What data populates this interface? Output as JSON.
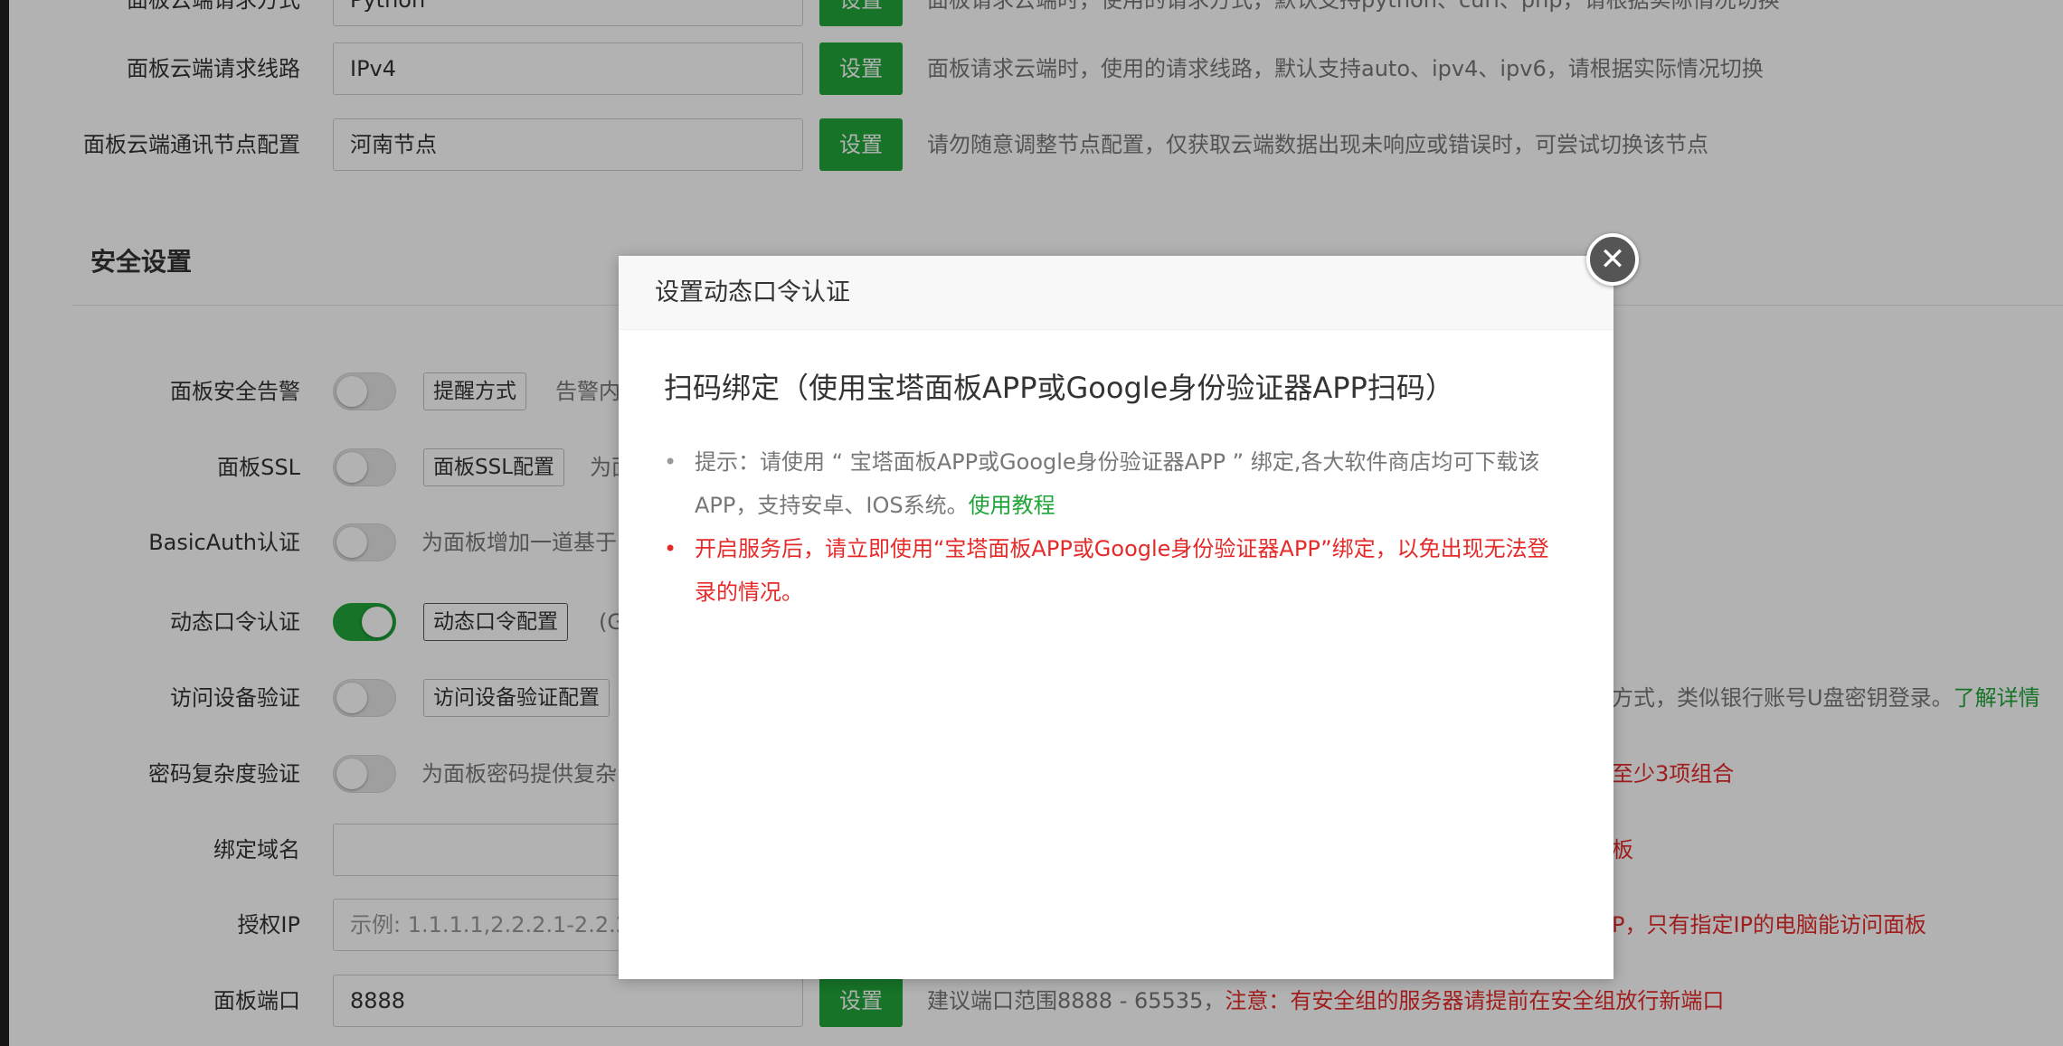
{
  "rows_top": [
    {
      "label": "面板云端请求方式",
      "value": "Python",
      "button": "设置",
      "hint": "面板请求云端时，使用的请求方式，默认支持python、curl、php，请根据实际情况切换"
    },
    {
      "label": "面板云端请求线路",
      "value": "IPv4",
      "button": "设置",
      "hint": "面板请求云端时，使用的请求线路，默认支持auto、ipv4、ipv6，请根据实际情况切换"
    },
    {
      "label": "面板云端通讯节点配置",
      "value": "河南节点",
      "button": "设置",
      "hint": "请勿随意调整节点配置，仅获取云端数据出现未响应或错误时，可尝试切换该节点"
    }
  ],
  "section": {
    "title": "安全设置"
  },
  "security_rows": [
    {
      "label": "面板安全告警",
      "enabled": false,
      "button": "提醒方式",
      "hint": "告警内"
    },
    {
      "label": "面板SSL",
      "enabled": false,
      "button": "面板SSL配置",
      "hint": "为面"
    },
    {
      "label": "BasicAuth认证",
      "enabled": false,
      "hint": "为面板增加一道基于"
    },
    {
      "label": "动态口令认证",
      "enabled": true,
      "button": "动态口令配置",
      "hint": "(G"
    },
    {
      "label": "访问设备验证",
      "enabled": false,
      "button": "访问设备验证配置",
      "hint_right": "方式，类似银行账号U盘密钥登录。",
      "hint_right_link": "了解详情"
    },
    {
      "label": "密码复杂度验证",
      "enabled": false,
      "hint": "为面板密码提供复杂",
      "hint_right": "至少3项组合"
    }
  ],
  "domain_row": {
    "label": "绑定域名",
    "value": "",
    "hint_right": "板"
  },
  "ip_row": {
    "label": "授权IP",
    "placeholder": "示例: 1.1.1.1,2.2.2.1-2.2.2.2",
    "hint_right": "P，只有指定IP的电脑能访问面板"
  },
  "port_row": {
    "label": "面板端口",
    "value": "8888",
    "button": "设置",
    "hint": "建议端口范围8888 - 65535，",
    "hint_red": "注意：有安全组的服务器请提前在安全组放行新端口"
  },
  "modal": {
    "header": "设置动态口令认证",
    "title": "扫码绑定（使用宝塔面板APP或Google身份验证器APP扫码）",
    "tip1_text": "提示：请使用 “ 宝塔面板APP或Google身份验证器APP ” 绑定,各大软件商店均可下载该APP，支持安卓、IOS系统。",
    "tip1_link": "使用教程",
    "tip2_text": "开启服务后，请立即使用“宝塔面板APP或Google身份验证器APP”绑定，以免出现无法登录的情况。",
    "bullet": "•",
    "close_symbol": "✕"
  },
  "colors": {
    "primary": "#20a53a",
    "danger": "#e52a2a",
    "overlay": "rgba(0,0,0,0.30)"
  }
}
